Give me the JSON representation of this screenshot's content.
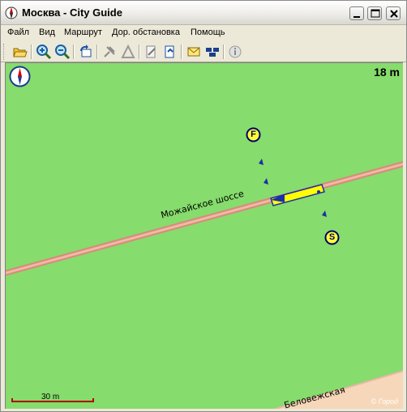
{
  "window": {
    "title": "Москва - City Guide"
  },
  "menu": {
    "items": [
      "Файл",
      "Вид",
      "Маршрут",
      "Дор. обстановка",
      "Помощь"
    ]
  },
  "toolbar": {
    "buttons": [
      "open-folder-icon",
      "zoom-in-icon",
      "zoom-out-icon",
      "rotate-icon",
      "satellite-icon",
      "navigate-icon",
      "edit-route-icon",
      "route-refresh-icon",
      "message-icon",
      "traffic-icon",
      "info-icon"
    ]
  },
  "map": {
    "zoom_label": "18 m",
    "scale_label": "30 m",
    "streets": [
      "Можайское шоссе",
      "Беловежская"
    ],
    "markers": {
      "finish": "F",
      "start": "S"
    },
    "copyright": "© Город",
    "colors": {
      "background": "#86dc6c",
      "road": "#e8a08c",
      "route": "#ffff00",
      "marker": "#0000a0"
    }
  }
}
